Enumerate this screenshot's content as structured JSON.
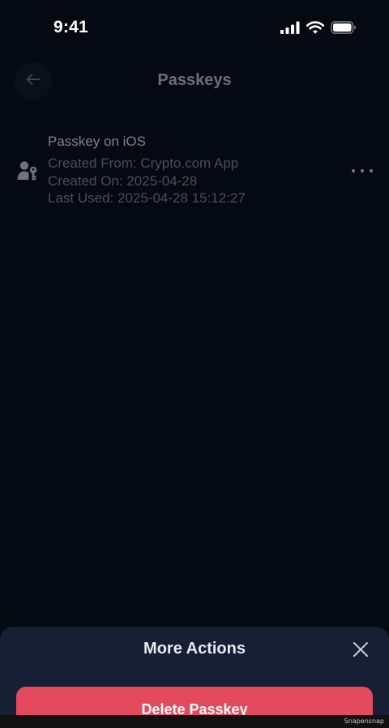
{
  "status_bar": {
    "time": "9:41"
  },
  "header": {
    "title": "Passkeys"
  },
  "passkeys": [
    {
      "name": "Passkey on iOS",
      "created_from": "Created From: Crypto.com App",
      "created_on": "Created On: 2025-04-28",
      "last_used": "Last Used: 2025-04-28 15:12:27"
    }
  ],
  "sheet": {
    "title": "More Actions",
    "delete_label": "Delete Passkey"
  },
  "watermark": "Snapensnap",
  "colors": {
    "background": "#050912",
    "sheet": "#161f33",
    "danger": "#e34a5e"
  }
}
